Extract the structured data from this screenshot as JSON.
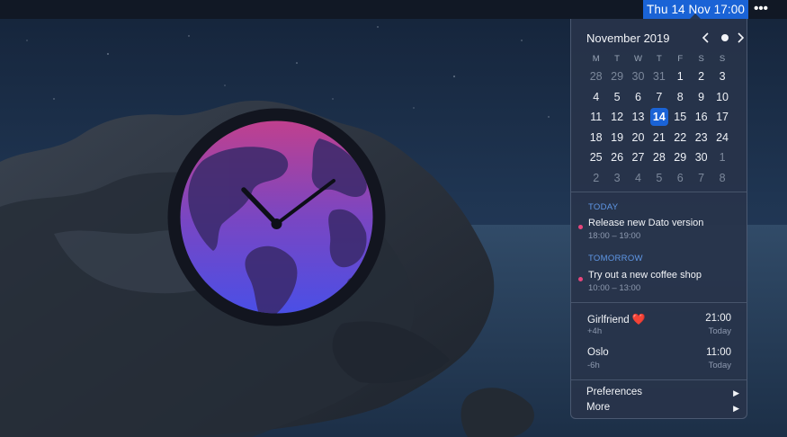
{
  "menubar": {
    "clock": "Thu 14 Nov  17:00",
    "more_icon": "more-icon"
  },
  "calendar": {
    "title": "November 2019",
    "weekdays": [
      "M",
      "T",
      "W",
      "T",
      "F",
      "S",
      "S"
    ],
    "weeks": [
      [
        {
          "d": "28",
          "dim": true
        },
        {
          "d": "29",
          "dim": true
        },
        {
          "d": "30",
          "dim": true
        },
        {
          "d": "31",
          "dim": true
        },
        {
          "d": "1"
        },
        {
          "d": "2"
        },
        {
          "d": "3"
        }
      ],
      [
        {
          "d": "4"
        },
        {
          "d": "5"
        },
        {
          "d": "6"
        },
        {
          "d": "7"
        },
        {
          "d": "8"
        },
        {
          "d": "9"
        },
        {
          "d": "10"
        }
      ],
      [
        {
          "d": "11"
        },
        {
          "d": "12"
        },
        {
          "d": "13"
        },
        {
          "d": "14",
          "today": true
        },
        {
          "d": "15"
        },
        {
          "d": "16"
        },
        {
          "d": "17"
        }
      ],
      [
        {
          "d": "18"
        },
        {
          "d": "19"
        },
        {
          "d": "20"
        },
        {
          "d": "21"
        },
        {
          "d": "22"
        },
        {
          "d": "23"
        },
        {
          "d": "24"
        }
      ],
      [
        {
          "d": "25"
        },
        {
          "d": "26"
        },
        {
          "d": "27"
        },
        {
          "d": "28"
        },
        {
          "d": "29"
        },
        {
          "d": "30"
        },
        {
          "d": "1",
          "dim": true
        }
      ],
      [
        {
          "d": "2",
          "dim": true
        },
        {
          "d": "3",
          "dim": true
        },
        {
          "d": "4",
          "dim": true
        },
        {
          "d": "5",
          "dim": true
        },
        {
          "d": "6",
          "dim": true
        },
        {
          "d": "7",
          "dim": true
        },
        {
          "d": "8",
          "dim": true
        }
      ]
    ]
  },
  "events": {
    "today_label": "TODAY",
    "today": {
      "title": "Release new Dato version",
      "time": "18:00 – 19:00"
    },
    "tomorrow_label": "TOMORROW",
    "tomorrow": {
      "title": "Try out a new coffee shop",
      "time": "10:00 – 13:00"
    }
  },
  "timezones": [
    {
      "name": "Girlfriend",
      "emoji": "❤️",
      "offset": "+4h",
      "time": "21:00",
      "day": "Today"
    },
    {
      "name": "Oslo",
      "emoji": "",
      "offset": "-6h",
      "time": "11:00",
      "day": "Today"
    }
  ],
  "menu": {
    "preferences": "Preferences",
    "more": "More"
  },
  "colors": {
    "accent": "#1a63d6",
    "event_dot": "#e8467c",
    "section_label": "#5f97e6"
  }
}
